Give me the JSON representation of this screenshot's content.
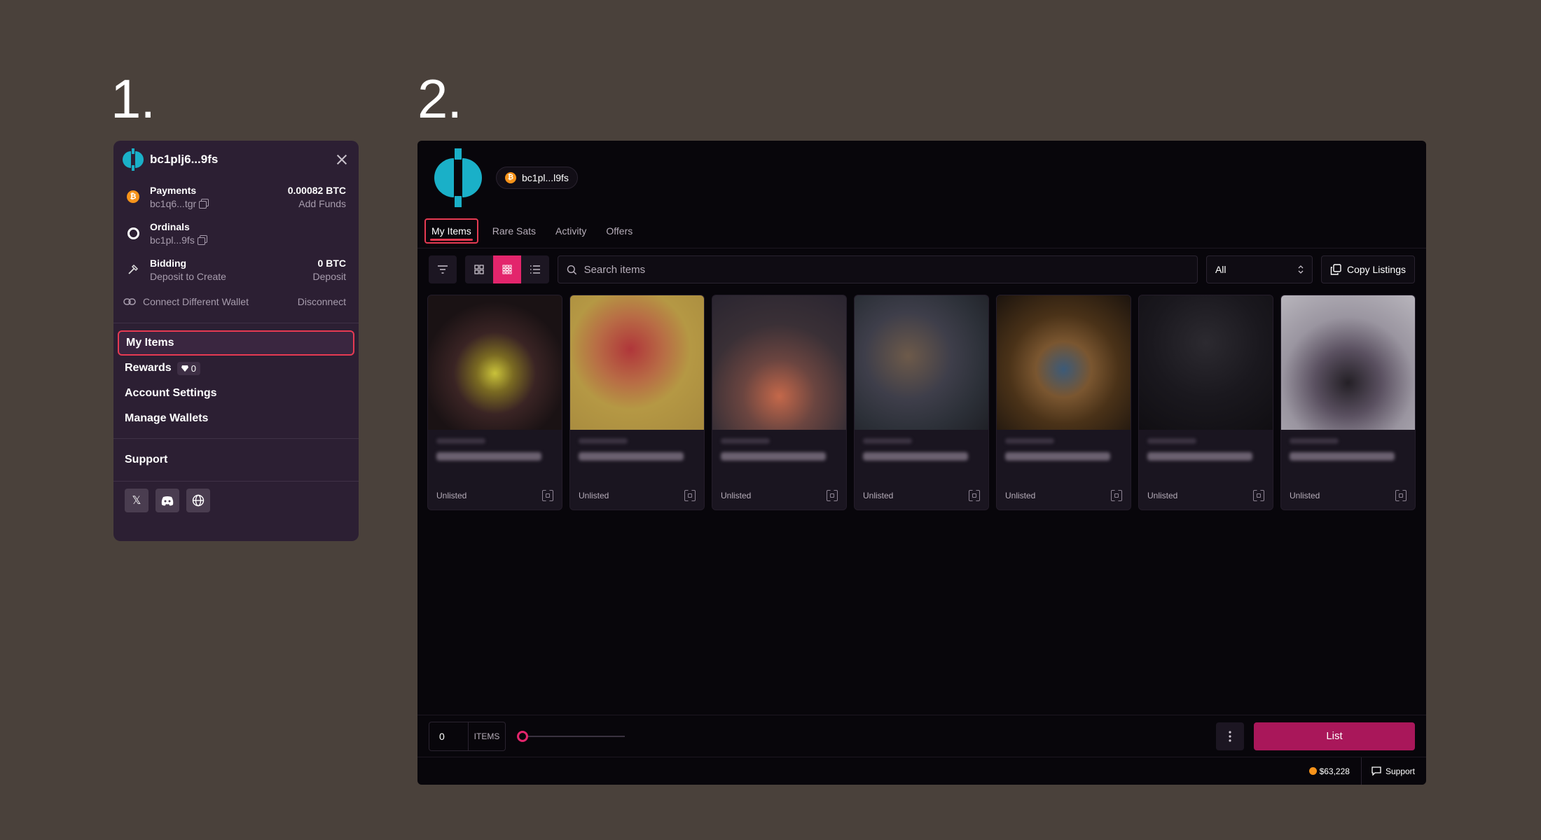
{
  "steps": {
    "one": "1.",
    "two": "2."
  },
  "wallet_menu": {
    "address": "bc1plj6...9fs",
    "payments": {
      "title": "Payments",
      "address": "bc1q6...tgr",
      "amount": "0.00082 BTC",
      "action": "Add Funds"
    },
    "ordinals": {
      "title": "Ordinals",
      "address": "bc1pl...9fs"
    },
    "bidding": {
      "title": "Bidding",
      "sub": "Deposit to Create",
      "amount": "0 BTC",
      "action": "Deposit"
    },
    "connect_label": "Connect Different Wallet",
    "disconnect_label": "Disconnect",
    "nav": {
      "my_items": "My Items",
      "rewards": "Rewards",
      "rewards_count": "0",
      "account_settings": "Account Settings",
      "manage_wallets": "Manage Wallets",
      "support": "Support"
    }
  },
  "app": {
    "wallet_chip": "bc1pl...l9fs",
    "tabs": [
      "My Items",
      "Rare Sats",
      "Activity",
      "Offers"
    ],
    "search_placeholder": "Search items",
    "filter_value": "All",
    "copy_listings": "Copy Listings",
    "cards": [
      {
        "status": "Unlisted",
        "gradient": "radial-gradient(circle at 50% 58%, #c9c23a 0%, #7a6a22 18%, #3a2424 40%, #1a1214 70%)"
      },
      {
        "status": "Unlisted",
        "gradient": "radial-gradient(circle at 45% 40%, #b0363a 0%, #b86b45 30%, #b59844 55%, #a78a3e 100%)"
      },
      {
        "status": "Unlisted",
        "gradient": "radial-gradient(circle at 50% 75%, #c4684a 0%, #6b4540 30%, #3a3036 60%, #2a2530 100%)"
      },
      {
        "status": "Unlisted",
        "gradient": "radial-gradient(circle at 40% 45%, #6d5a4a 0%, #3e3e4a 40%, #2c3038 70%, #1f2026 100%)"
      },
      {
        "status": "Unlisted",
        "gradient": "radial-gradient(circle at 50% 55%, #3c5a78 0%, #7a5630 28%, #4a3218 55%, #1c140e 100%)"
      },
      {
        "status": "Unlisted",
        "gradient": "radial-gradient(circle at 50% 35%, #2c2a30 0%, #1a181e 50%, #100e12 100%)"
      },
      {
        "status": "Unlisted",
        "gradient": "radial-gradient(circle at 50% 65%, #242026 0%, #5a5060 30%, #9a95a0 60%, #b8b5bc 100%)"
      }
    ],
    "quantity": "0",
    "items_label": "ITEMS",
    "list_label": "List",
    "btc_price": "$63,228",
    "support_label": "Support"
  },
  "colors": {
    "accent": "#e3256c",
    "highlight": "#e63a52",
    "btc": "#f7931a",
    "brand": "#1ab0c8"
  }
}
